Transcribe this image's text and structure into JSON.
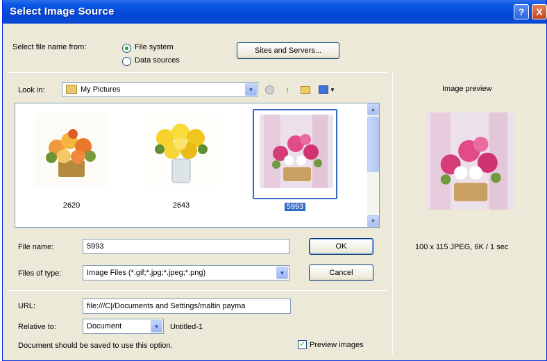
{
  "window": {
    "title": "Select Image Source",
    "help_glyph": "?",
    "close_glyph": "X"
  },
  "source": {
    "label": "Select file name from:",
    "options": [
      "File system",
      "Data sources"
    ],
    "selected": "File system",
    "sites_button": "Sites and Servers..."
  },
  "lookin": {
    "label": "Look in:",
    "value": "My Pictures"
  },
  "files": [
    {
      "name": "2620",
      "selected": false
    },
    {
      "name": "2643",
      "selected": false
    },
    {
      "name": "5993",
      "selected": true
    }
  ],
  "filename": {
    "label": "File name:",
    "value": "5993"
  },
  "filetype": {
    "label": "Files of type:",
    "value": "Image Files (*.gif;*.jpg;*.jpeg;*.png)"
  },
  "buttons": {
    "ok": "OK",
    "cancel": "Cancel"
  },
  "url": {
    "label": "URL:",
    "value": "file:///C|/Documents and Settings/maltin payma"
  },
  "relative": {
    "label": "Relative to:",
    "value": "Document",
    "doc_name": "Untitled-1"
  },
  "notice": "Document should be saved to use this option.",
  "preview_images": {
    "label": "Preview images",
    "checked": true
  },
  "preview": {
    "title": "Image preview",
    "info": "100 x 115 JPEG, 6K / 1 sec"
  },
  "colors": {
    "title_bar": "#0a58e6",
    "dialog_bg": "#ece9d8",
    "selection": "#316ac5"
  }
}
